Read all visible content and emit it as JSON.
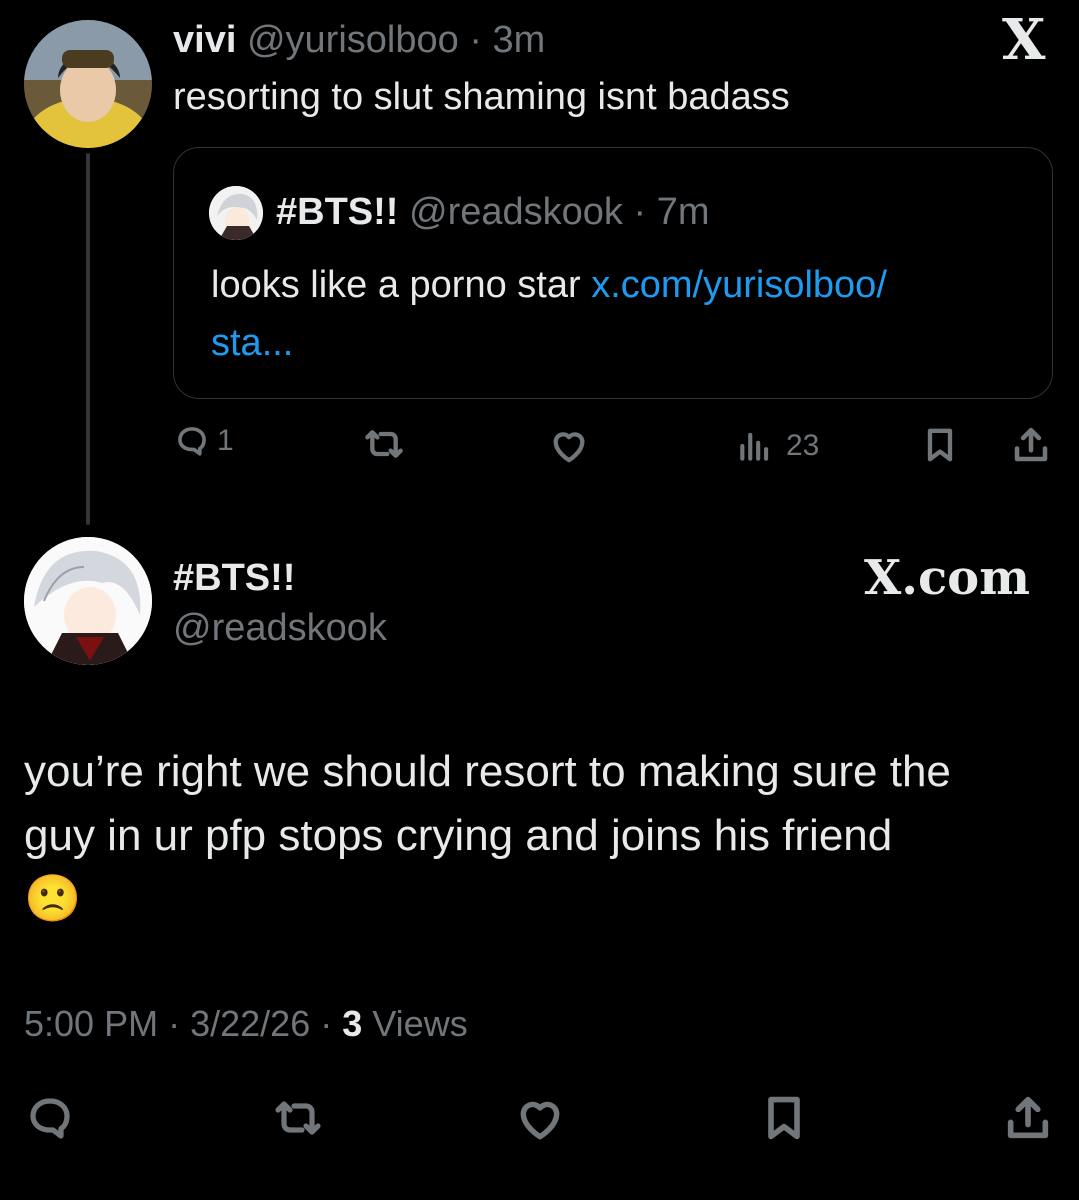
{
  "reply": {
    "display_name": "vivi",
    "handle": "@yurisolboo",
    "separator": "·",
    "time": "3m",
    "text": "resorting to slut shaming isnt badass",
    "quote": {
      "display_name": "#BTS!!",
      "handle": "@readskook",
      "separator": "·",
      "time": "7m",
      "text": "looks like a porno star",
      "link_line1": "x.com/yurisolboo/",
      "link_line2": "sta..."
    },
    "actions": {
      "replies": "1",
      "views": "23"
    },
    "logo": "X"
  },
  "main": {
    "display_name": "#BTS!!",
    "handle": "@readskook",
    "logo_text": "X.com",
    "text_line1": "you’re right we should resort to making sure the",
    "text_line2": "guy in ur pfp stops crying and joins his friend",
    "emoji": "🙁",
    "time": "5:00 PM",
    "dot": "·",
    "date": "3/22/26",
    "dot2": "·",
    "views_count": "3",
    "views_label": "Views"
  }
}
